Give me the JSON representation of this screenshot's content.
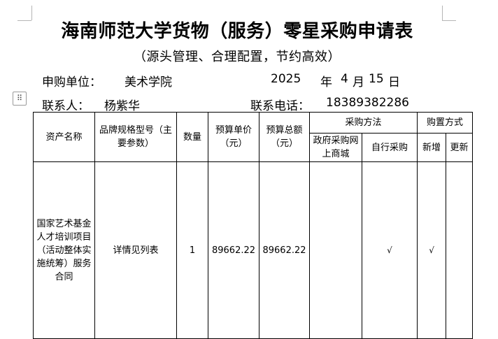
{
  "title": "海南师范大学货物（服务）零星采购申请表",
  "subtitle": "（源头管理、合理配置，节约高效）",
  "info": {
    "unit_label": "申购单位：",
    "unit_value": "美术学院",
    "year": "2025",
    "year_suffix": "年",
    "month": "4",
    "month_suffix": "月",
    "day": "15",
    "day_suffix": "日",
    "contact_label": "联系人：",
    "contact_value": "杨紫华",
    "phone_label": "联系电话：",
    "phone_value": "18389382286"
  },
  "handle_glyph": "⠿",
  "table": {
    "headers": {
      "asset_name": "资产名称",
      "brand_spec": "品牌规格型号（主要参数）",
      "quantity": "数量",
      "unit_price": "预算单价（元）",
      "total_price": "预算总额（元）",
      "method": "采购方法",
      "method_gov": "政府采购网上商城",
      "method_self": "自行采购",
      "purchase_type": "购置方式",
      "type_new": "新增",
      "type_renew": "更新"
    },
    "rows": [
      {
        "asset_name": "国家艺术基金人才培训项目（活动整体实施统筹）服务合同",
        "brand_spec": "详情见列表",
        "quantity": "1",
        "unit_price": "89662.22",
        "total_price": "89662.22",
        "gov_mall": "",
        "self_purchase": "√",
        "new": "√",
        "renew": ""
      }
    ]
  }
}
